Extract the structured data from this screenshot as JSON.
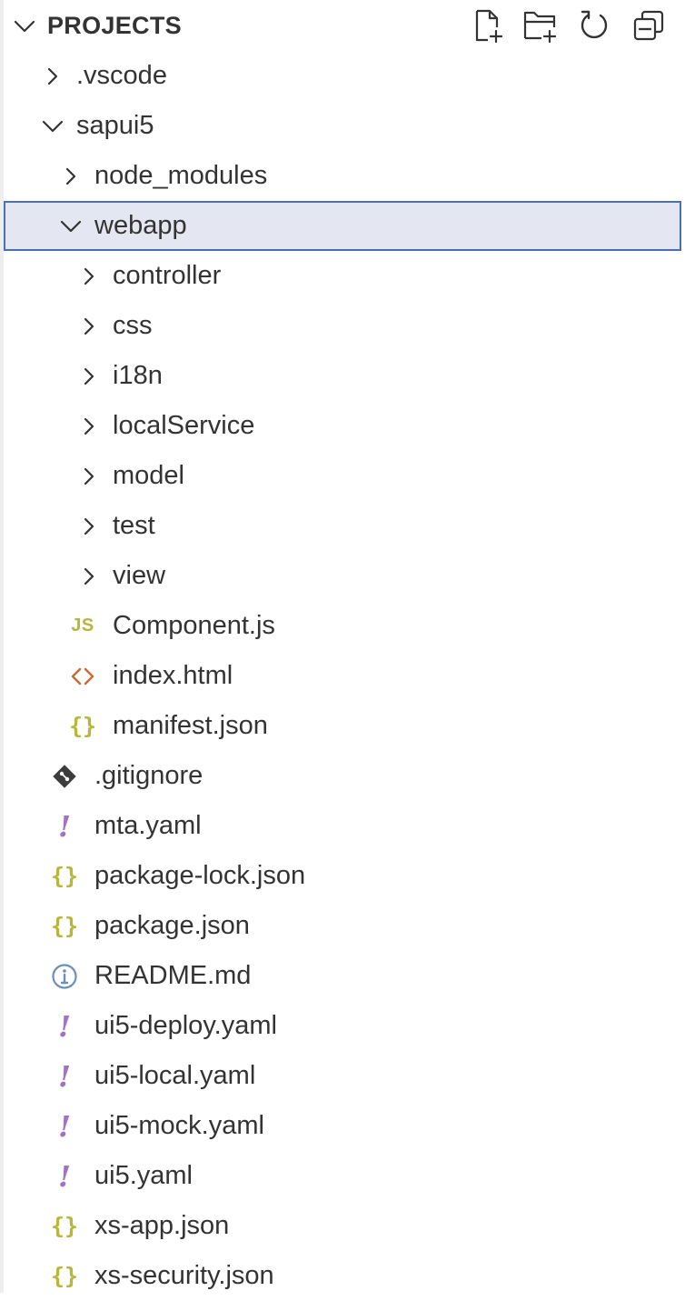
{
  "explorer": {
    "section_title": "PROJECTS",
    "actions": [
      {
        "name": "new-file-icon"
      },
      {
        "name": "new-folder-icon"
      },
      {
        "name": "refresh-icon"
      },
      {
        "name": "collapse-all-icon"
      }
    ],
    "items": [
      {
        "label": ".vscode",
        "type": "folder",
        "expanded": false,
        "depth": 1
      },
      {
        "label": "sapui5",
        "type": "folder",
        "expanded": true,
        "depth": 1
      },
      {
        "label": "node_modules",
        "type": "folder",
        "expanded": false,
        "depth": 2
      },
      {
        "label": "webapp",
        "type": "folder",
        "expanded": true,
        "depth": 2,
        "selected": true
      },
      {
        "label": "controller",
        "type": "folder",
        "expanded": false,
        "depth": 3
      },
      {
        "label": "css",
        "type": "folder",
        "expanded": false,
        "depth": 3
      },
      {
        "label": "i18n",
        "type": "folder",
        "expanded": false,
        "depth": 3
      },
      {
        "label": "localService",
        "type": "folder",
        "expanded": false,
        "depth": 3
      },
      {
        "label": "model",
        "type": "folder",
        "expanded": false,
        "depth": 3
      },
      {
        "label": "test",
        "type": "folder",
        "expanded": false,
        "depth": 3
      },
      {
        "label": "view",
        "type": "folder",
        "expanded": false,
        "depth": 3
      },
      {
        "label": "Component.js",
        "type": "file",
        "icon": "js",
        "icon_text": "JS",
        "depth": 3
      },
      {
        "label": "index.html",
        "type": "file",
        "icon": "html",
        "depth": 3
      },
      {
        "label": "manifest.json",
        "type": "file",
        "icon": "json",
        "icon_text": "{}",
        "depth": 3
      },
      {
        "label": ".gitignore",
        "type": "file",
        "icon": "git",
        "depth": 2
      },
      {
        "label": "mta.yaml",
        "type": "file",
        "icon": "yaml",
        "icon_text": "!",
        "depth": 2
      },
      {
        "label": "package-lock.json",
        "type": "file",
        "icon": "json",
        "icon_text": "{}",
        "depth": 2
      },
      {
        "label": "package.json",
        "type": "file",
        "icon": "json",
        "icon_text": "{}",
        "depth": 2
      },
      {
        "label": "README.md",
        "type": "file",
        "icon": "info",
        "depth": 2
      },
      {
        "label": "ui5-deploy.yaml",
        "type": "file",
        "icon": "yaml",
        "icon_text": "!",
        "depth": 2
      },
      {
        "label": "ui5-local.yaml",
        "type": "file",
        "icon": "yaml",
        "icon_text": "!",
        "depth": 2
      },
      {
        "label": "ui5-mock.yaml",
        "type": "file",
        "icon": "yaml",
        "icon_text": "!",
        "depth": 2
      },
      {
        "label": "ui5.yaml",
        "type": "file",
        "icon": "yaml",
        "icon_text": "!",
        "depth": 2
      },
      {
        "label": "xs-app.json",
        "type": "file",
        "icon": "json",
        "icon_text": "{}",
        "depth": 2
      },
      {
        "label": "xs-security.json",
        "type": "file",
        "icon": "json",
        "icon_text": "{}",
        "depth": 2
      }
    ]
  },
  "colors": {
    "text": "#333333",
    "selection_bg": "#e4e6f1",
    "selection_border": "#4a6fb5",
    "json_icon": "#b7b73b",
    "js_icon": "#b7b73b",
    "yaml_icon": "#a074c4",
    "html_icon": "#c4703a",
    "info_icon": "#6c8ebf",
    "git_icon": "#3c3c3c"
  }
}
